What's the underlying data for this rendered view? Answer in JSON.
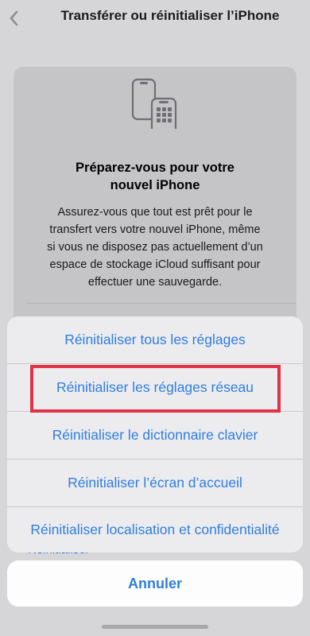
{
  "header": {
    "title": "Transférer ou réinitialiser l’iPhone",
    "back_icon": "chevron-left-icon"
  },
  "card": {
    "icon": "phones-transfer-icon",
    "title_line1": "Préparez-vous pour votre",
    "title_line2": "nouvel iPhone",
    "body_line1": "Assurez-vous que tout est prêt pour le",
    "body_line2": "transfert vers votre nouvel iPhone, même",
    "body_line3": "si vous ne disposez pas actuellement d’un",
    "body_line4": "espace de stockage iCloud suffisant pour",
    "body_line5": "effectuer une sauvegarde.",
    "peek_label": "Réinitialiser"
  },
  "action_sheet": {
    "items": [
      {
        "label": "Réinitialiser tous les réglages"
      },
      {
        "label": "Réinitialiser les réglages réseau"
      },
      {
        "label": "Réinitialiser le dictionnaire clavier"
      },
      {
        "label": "Réinitialiser l’écran d’accueil"
      },
      {
        "label": "Réinitialiser localisation et confidentialité"
      }
    ],
    "cancel_label": "Annuler"
  },
  "colors": {
    "accent": "#2f7de1",
    "highlight": "#e03348"
  }
}
